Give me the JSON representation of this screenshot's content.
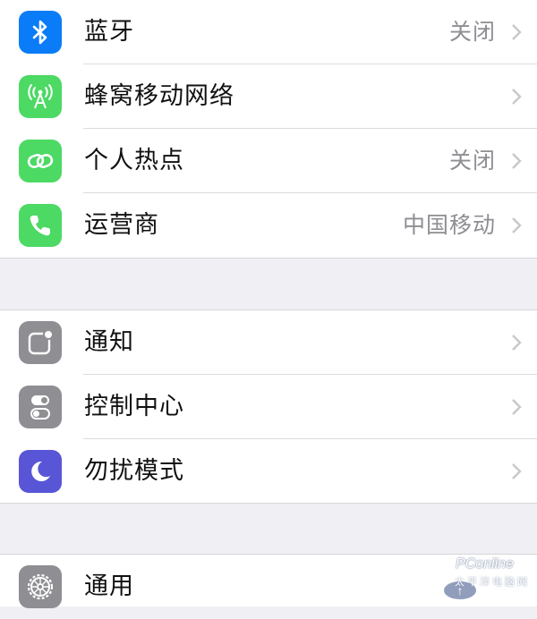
{
  "colors": {
    "background": "#efeff4",
    "bluetooth": "#0a7cf7",
    "green": "#4cd964",
    "gray": "#8e8e93",
    "purple": "#5856d6"
  },
  "section1": {
    "rows": [
      {
        "label": "蓝牙",
        "value": "关闭",
        "icon": "bluetooth-icon"
      },
      {
        "label": "蜂窝移动网络",
        "value": "",
        "icon": "cellular-antenna-icon"
      },
      {
        "label": "个人热点",
        "value": "关闭",
        "icon": "hotspot-chain-icon"
      },
      {
        "label": "运营商",
        "value": "中国移动",
        "icon": "phone-icon"
      }
    ]
  },
  "section2": {
    "rows": [
      {
        "label": "通知",
        "value": "",
        "icon": "notifications-icon"
      },
      {
        "label": "控制中心",
        "value": "",
        "icon": "control-center-icon"
      },
      {
        "label": "勿扰模式",
        "value": "",
        "icon": "moon-icon"
      }
    ]
  },
  "section3": {
    "rows": [
      {
        "label": "通用",
        "value": "",
        "icon": "gear-icon"
      }
    ]
  },
  "watermark": {
    "brand": "PConline",
    "sub": "太平洋电脑网"
  }
}
